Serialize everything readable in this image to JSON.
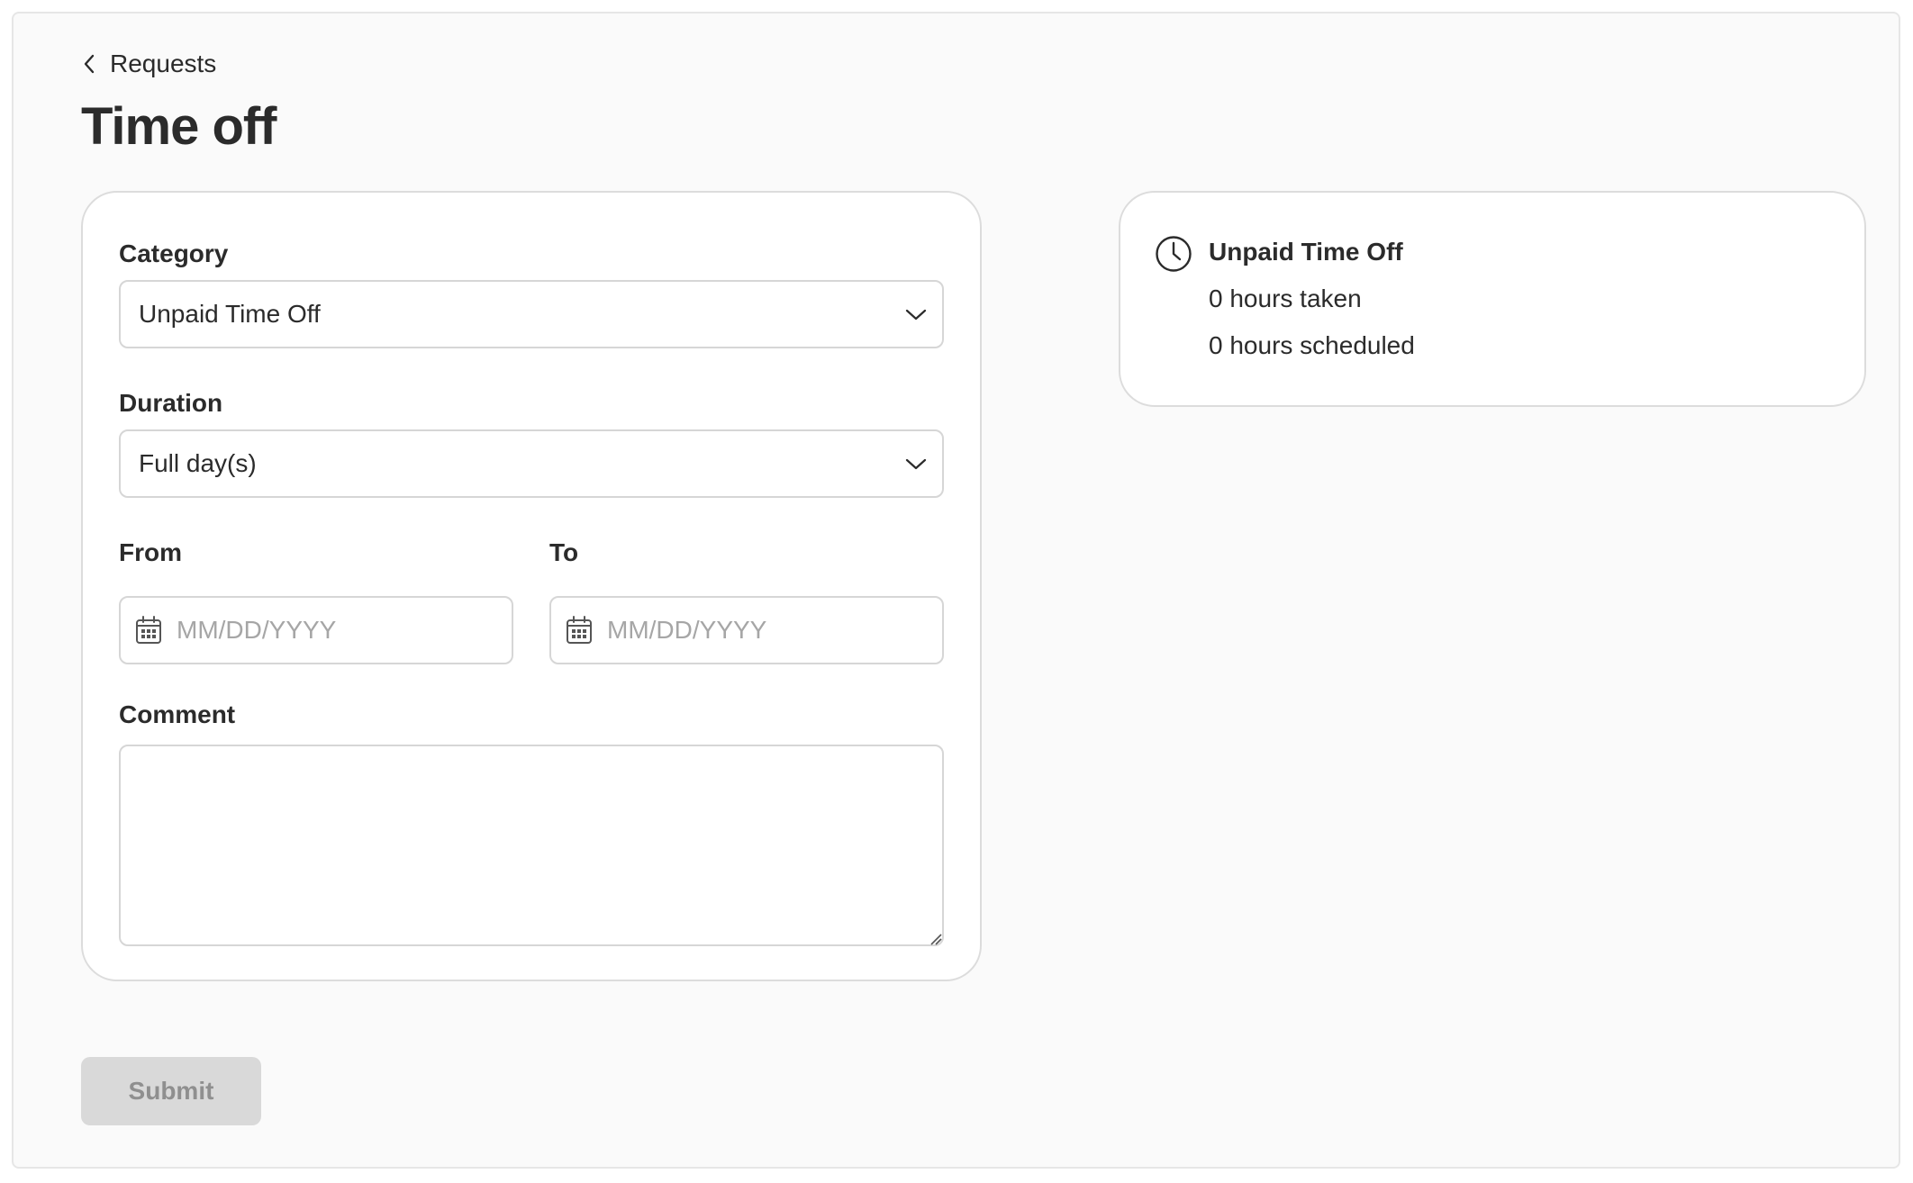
{
  "breadcrumb": {
    "back_label": "Requests"
  },
  "page": {
    "title": "Time off"
  },
  "form": {
    "category": {
      "label": "Category",
      "value": "Unpaid Time Off"
    },
    "duration": {
      "label": "Duration",
      "value": "Full day(s)"
    },
    "from": {
      "label": "From",
      "placeholder": "MM/DD/YYYY"
    },
    "to": {
      "label": "To",
      "placeholder": "MM/DD/YYYY"
    },
    "comment": {
      "label": "Comment",
      "value": ""
    }
  },
  "summary": {
    "title": "Unpaid Time Off",
    "taken": "0 hours taken",
    "scheduled": "0 hours scheduled",
    "icon": "clock-icon"
  },
  "actions": {
    "submit_label": "Submit",
    "submit_enabled": false
  },
  "colors": {
    "background": "#fafafa",
    "card": "#ffffff",
    "border": "#d6d6d6",
    "text": "#2b2b2b",
    "placeholder": "#a6a6a6",
    "disabled_button": "#d9d9d9",
    "disabled_text": "#8f8f8f"
  }
}
